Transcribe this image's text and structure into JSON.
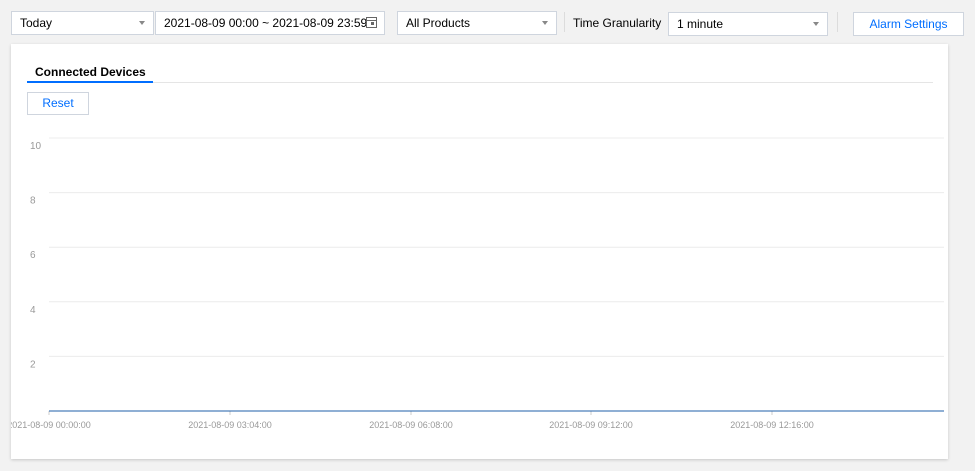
{
  "toolbar": {
    "period_select": "Today",
    "date_range": "2021-08-09 00:00 ~ 2021-08-09 23:59",
    "product_select": "All Products",
    "granularity_label": "Time Granularity",
    "granularity_select": "1 minute",
    "alarm_settings_label": "Alarm Settings"
  },
  "panel": {
    "tab_label": "Connected Devices",
    "reset_label": "Reset"
  },
  "colors": {
    "accent": "#006eff",
    "series_line": "#1f5fa8"
  },
  "chart_data": {
    "type": "line",
    "y_ticks": [
      "2",
      "4",
      "6",
      "8",
      "10"
    ],
    "x_ticks": [
      "2021-08-09 00:00:00",
      "2021-08-09 03:04:00",
      "2021-08-09 06:08:00",
      "2021-08-09 09:12:00",
      "2021-08-09 12:16:00"
    ],
    "ylim": [
      0,
      10
    ],
    "grid": true,
    "series": [
      {
        "values": [
          0,
          0,
          0,
          0,
          0
        ]
      }
    ]
  }
}
